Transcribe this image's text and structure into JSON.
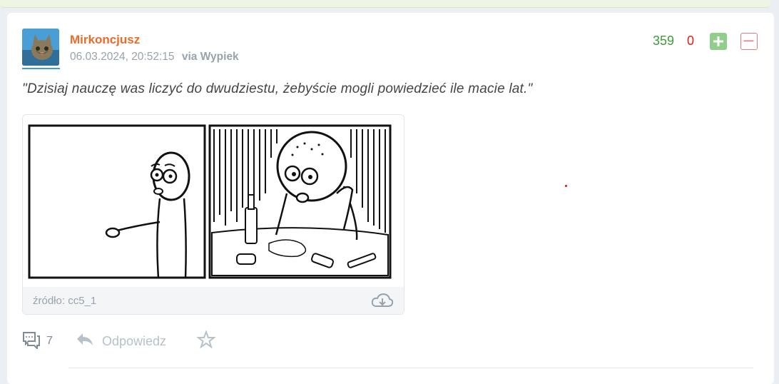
{
  "entry": {
    "author": "Mirkoncjusz",
    "date": "06.03.2024, 20:52:15",
    "via": "via Wypiek",
    "votes_plus": "359",
    "votes_minus": "0",
    "text": "\"Dzisiaj nauczę was liczyć do dwudziestu, żebyście mogli powiedzieć ile macie lat.\"",
    "embed": {
      "source": "źródło: cc5_1"
    },
    "actions": {
      "comments_count": "7",
      "reply_label": "Odpowiedz"
    }
  },
  "colors": {
    "author": "#ee6a27",
    "vote_plus": "#3e9a3b",
    "vote_minus": "#d6221b",
    "meta": "#98a3ad"
  },
  "icons": [
    "cat-avatar",
    "plus-icon",
    "minus-icon",
    "download-cloud-icon",
    "comments-icon",
    "reply-icon",
    "star-icon"
  ]
}
